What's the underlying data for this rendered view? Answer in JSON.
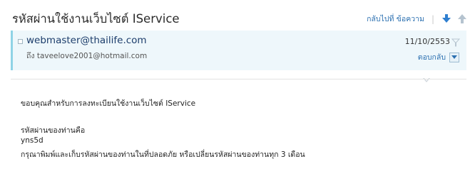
{
  "subject": "รหัสผ่านใช้งานเว็บไซต์ IService",
  "toolbar": {
    "back_label": "กลับไปที่ ข้อความ",
    "separator": "|",
    "next_icon": "arrow-down-icon",
    "prev_icon": "arrow-up-icon"
  },
  "header": {
    "sender": "webmaster@thailife.com",
    "recipient": "ถึง taveelove2001@hotmail.com",
    "date": "11/10/2553",
    "reply_label": "ตอบกลับ",
    "flag_icon": "flag-icon",
    "reply_menu_icon": "chevron-down-icon"
  },
  "body": {
    "greeting": "ขอบคุณสำหรับการลงทะเบียนใช้งานเว็บไซต์ IService",
    "password_label": "รหัสผ่านของท่านคือ",
    "password_value": "yns5d",
    "instruction": "กรุณาพิมพ์และเก็บรหัสผ่านของท่านในที่ปลอดภัย หรือเปลี่ยนรหัสผ่านของท่านทุก 3 เดือน"
  },
  "colors": {
    "accent_link": "#2a6fb0",
    "header_bg": "#eef7fb",
    "header_border": "#8fd3e6",
    "sender_text": "#1c3d6b"
  }
}
